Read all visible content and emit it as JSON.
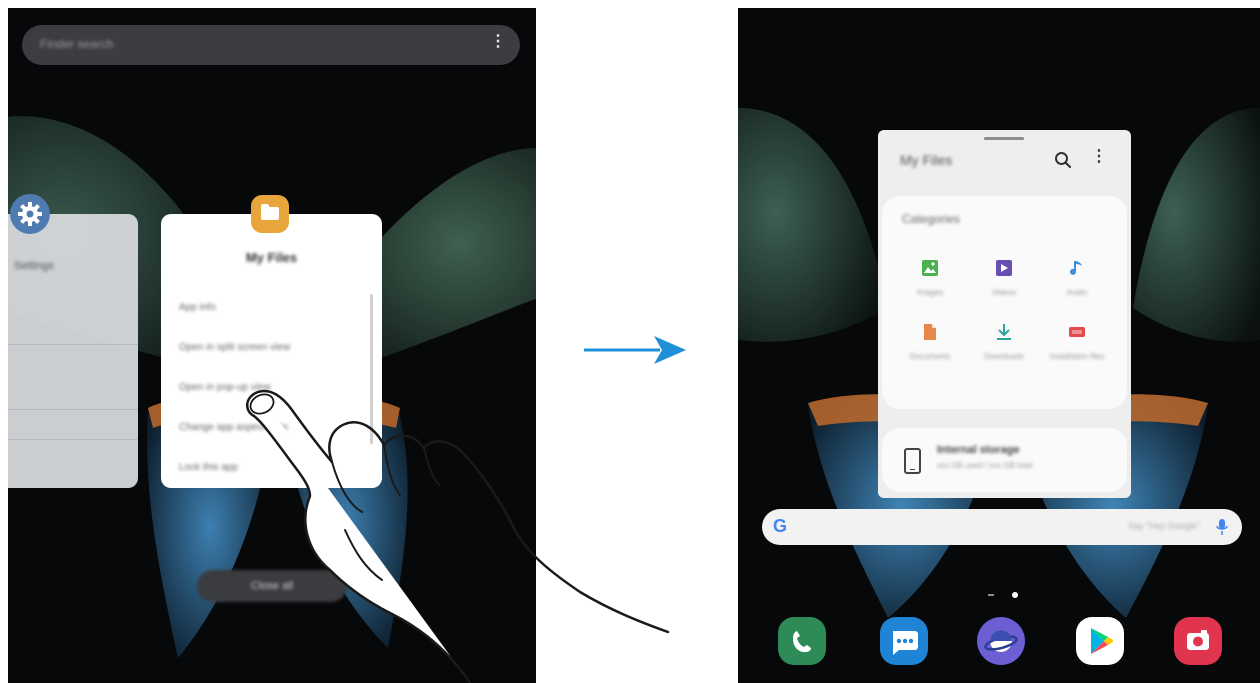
{
  "left_screen": {
    "search_placeholder": "Finder search",
    "more_icon": "⋮",
    "settings_card": {
      "title": "Settings"
    },
    "app_card": {
      "app_name": "My Files",
      "menu_items": [
        "App info",
        "Open in split screen view",
        "Open in pop-up view",
        "Change app aspect ratio",
        "Lock this app"
      ]
    },
    "close_all_label": "Close all"
  },
  "right_screen": {
    "popup": {
      "title": "My Files",
      "categories_title": "Categories",
      "categories": [
        {
          "label": "Images",
          "icon": "image-icon",
          "color": "#4caf50"
        },
        {
          "label": "Videos",
          "icon": "video-icon",
          "color": "#6a4fb3"
        },
        {
          "label": "Audio",
          "icon": "music-icon",
          "color": "#3f8fd8"
        },
        {
          "label": "Documents",
          "icon": "document-icon",
          "color": "#e8874a"
        },
        {
          "label": "Downloads",
          "icon": "download-icon",
          "color": "#2aa39a"
        },
        {
          "label": "Installation files",
          "icon": "apk-icon",
          "color": "#e24b4b"
        }
      ],
      "storage_title": "Internal storage",
      "storage_subtitle": "xxx GB used / xxx GB total"
    },
    "google_bar": {
      "logo": "G",
      "hint": "Say \"Hey Google\""
    },
    "dock": [
      {
        "name": "Phone",
        "icon": "phone-icon",
        "color": "#2e8b57"
      },
      {
        "name": "Messages",
        "icon": "messages-icon",
        "color": "#1f84d6"
      },
      {
        "name": "Internet",
        "icon": "internet-icon",
        "color": "#6b5fd3"
      },
      {
        "name": "Play Store",
        "icon": "play-store-icon",
        "color": "#ffffff"
      },
      {
        "name": "Camera",
        "icon": "camera-icon",
        "color": "#e0344f"
      }
    ]
  },
  "colors": {
    "screen_background": "#07080a",
    "arrow": "#1e90d8",
    "folder_accent": "#e8a53b"
  }
}
